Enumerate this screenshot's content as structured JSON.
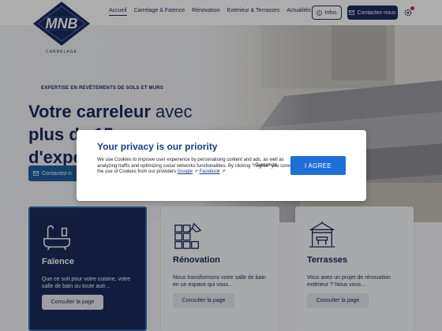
{
  "brand": {
    "letters": "MNB",
    "subtitle": "CARRELAGE"
  },
  "nav": {
    "items": [
      {
        "label": "Accueil",
        "active": true
      },
      {
        "label": "Carrelage & Faïence"
      },
      {
        "label": "Rénovation"
      },
      {
        "label": "Extérieur & Terrasses"
      },
      {
        "label": "Actualités"
      }
    ],
    "infos_label": "Infos",
    "contact_label": "Contactez-nous"
  },
  "hero": {
    "tagline": "EXPERTISE EN REVÊTEMENTS DE SOLS ET MURS",
    "headline_bold_1": "Votre carreleur",
    "headline_light_1": " avec",
    "headline_2": "plus de 15 ans",
    "headline_3": "d'expérience",
    "cta_label": "Contactez-n"
  },
  "cards": [
    {
      "title": "Faïence",
      "desc": "Que ce soit pour votre cuisine, votre salle de bain ou toute autr...",
      "button": "Consulter la page"
    },
    {
      "title": "Rénovation",
      "desc": "Nous transformons votre salle de bain en un espace qui vous...",
      "button": "Consulter la page"
    },
    {
      "title": "Terrasses",
      "desc": "Vous avez un projet de rénovation extérieur ? Nous vous...",
      "button": "Consulter la page"
    }
  ],
  "privacy_modal": {
    "title": "Your privacy is our priority",
    "text": "We use Cookies to improve user experience by personalising content and ads, as well as analyzing traffic and optimizing social networks functionalities. By clicking \"I Agree\" you consent to the use of Cookies from our providers ",
    "link_google": "Google",
    "link_facebook": "Facebook",
    "customize_label": "Customize",
    "agree_label": "I AGREE"
  },
  "colors": {
    "navy": "#1b2a5a",
    "accent_blue": "#1e6fd9",
    "modal_title": "#1b3b8f"
  }
}
